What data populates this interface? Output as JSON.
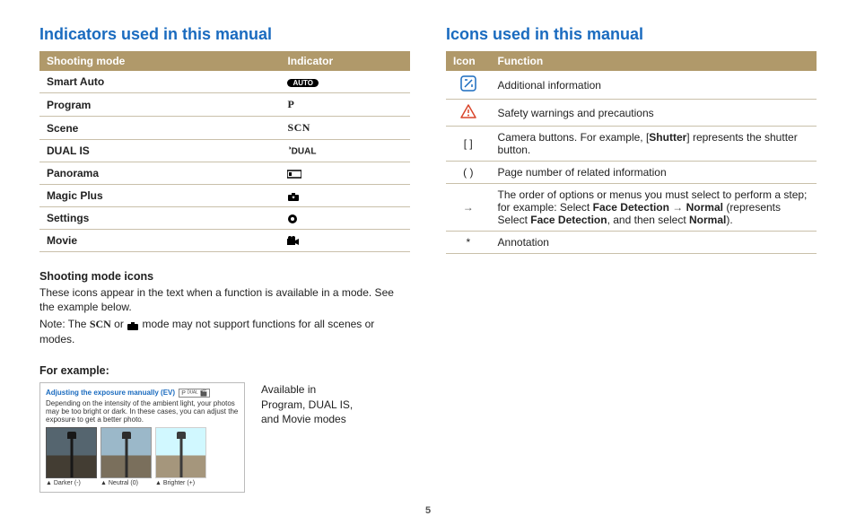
{
  "left": {
    "heading": "Indicators used in this manual",
    "tbl_h1": "Shooting mode",
    "tbl_h2": "Indicator",
    "rows": [
      {
        "mode": "Smart Auto",
        "ind": "AUTO"
      },
      {
        "mode": "Program",
        "ind": "P"
      },
      {
        "mode": "Scene",
        "ind": "SCN"
      },
      {
        "mode": "DUAL IS",
        "ind": "DUAL"
      },
      {
        "mode": "Panorama",
        "ind": "▭"
      },
      {
        "mode": "Magic Plus",
        "ind": "✦"
      },
      {
        "mode": "Settings",
        "ind": "⚙"
      },
      {
        "mode": "Movie",
        "ind": "🎬"
      }
    ],
    "sect1_title": "Shooting mode icons",
    "sect1_line1": "These icons appear in the text when a function is available in a mode. See the example below.",
    "sect1_line2a": "Note: The ",
    "sect1_scn": "SCN",
    "sect1_line2b": " or ",
    "sect1_line2c": " mode may not support functions for all scenes or modes.",
    "for_example": "For example:",
    "ex_title": "Adjusting the exposure manually (EV)",
    "ex_modes": "P ᴰᵁᴬᴸ 🎬",
    "ex_desc": "Depending on the intensity of the ambient light, your photos may be too bright or dark. In these cases, you can adjust the exposure to get a better photo.",
    "thumb_caps": [
      "▲ Darker (-)",
      "▲ Neutral (0)",
      "▲ Brighter (+)"
    ],
    "side_caption": "Available in Program, DUAL IS, and Movie modes"
  },
  "right": {
    "heading": "Icons used in this manual",
    "tbl_h1": "Icon",
    "tbl_h2": "Function",
    "rows": [
      {
        "icon": "note",
        "text": "Additional information"
      },
      {
        "icon": "warn",
        "text": "Safety warnings and precautions"
      },
      {
        "icon": "[ ]",
        "text_pre": "Camera buttons. For example, [",
        "bold": "Shutter",
        "text_post": "] represents the shutter button."
      },
      {
        "icon": "( )",
        "text": "Page number of related information"
      },
      {
        "icon": "→",
        "text_pre": "The order of options or menus you must select to perform a step; for example: Select ",
        "b1": "Face Detection",
        "mid": " → ",
        "b2": "Normal",
        "post1": " (represents Select ",
        "b3": "Face Detection",
        "post2": ", and then select ",
        "b4": "Normal",
        "post3": ")."
      },
      {
        "icon": "*",
        "text": "Annotation"
      }
    ]
  },
  "page_number": "5"
}
